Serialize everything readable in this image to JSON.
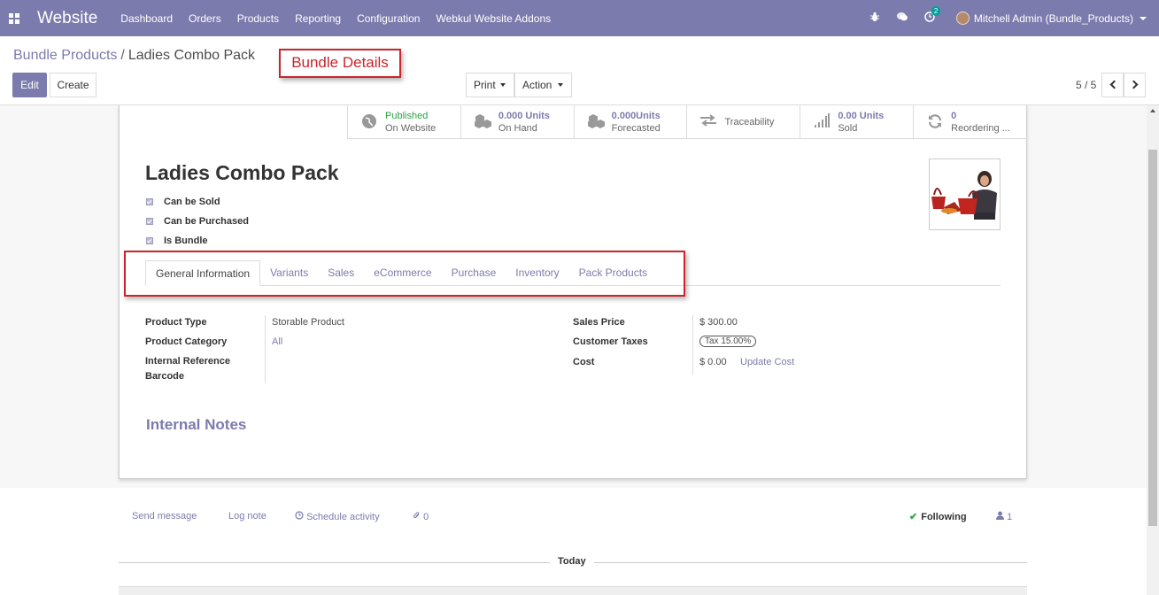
{
  "navbar": {
    "brand": "Website",
    "menu": [
      "Dashboard",
      "Orders",
      "Products",
      "Reporting",
      "Configuration",
      "Webkul Website Addons"
    ],
    "activity_count": "2",
    "user": "Mitchell Admin (Bundle_Products)"
  },
  "breadcrumb": {
    "parent": "Bundle Products",
    "separator": "/",
    "current": "Ladies Combo Pack"
  },
  "annotation": {
    "label": "Bundle Details",
    "color": "#c9252c"
  },
  "buttons": {
    "edit": "Edit",
    "create": "Create",
    "print": "Print",
    "action": "Action"
  },
  "pager": {
    "text": "5 / 5"
  },
  "smart_buttons": [
    {
      "icon": "globe-icon",
      "value": "Published",
      "label": "On Website"
    },
    {
      "icon": "cubes-icon",
      "value": "0.000 Units",
      "label": "On Hand"
    },
    {
      "icon": "cubes-icon",
      "value": "0.000Units",
      "label": "Forecasted"
    },
    {
      "icon": "exchange-icon",
      "value": "",
      "label": "Traceability"
    },
    {
      "icon": "signal-icon",
      "value": "0.00 Units",
      "label": "Sold"
    },
    {
      "icon": "refresh-icon",
      "value": "0",
      "label": "Reordering ..."
    }
  ],
  "product": {
    "name": "Ladies Combo Pack",
    "checkboxes": [
      "Can be Sold",
      "Can be Purchased",
      "Is Bundle"
    ]
  },
  "tabs": [
    "General Information",
    "Variants",
    "Sales",
    "eCommerce",
    "Purchase",
    "Inventory",
    "Pack Products"
  ],
  "fields_left": {
    "product_type_label": "Product Type",
    "product_type_value": "Storable Product",
    "category_label": "Product Category",
    "category_value": "All",
    "internal_ref_label": "Internal Reference",
    "barcode_label": "Barcode"
  },
  "fields_right": {
    "sales_price_label": "Sales Price",
    "sales_price_value": "$ 300.00",
    "taxes_label": "Customer Taxes",
    "taxes_value": "Tax 15.00%",
    "cost_label": "Cost",
    "cost_value": "$ 0.00",
    "update_cost": "Update Cost"
  },
  "notes_heading": "Internal Notes",
  "chatter": {
    "send_message": "Send message",
    "log_note": "Log note",
    "schedule_activity": "Schedule activity",
    "attachments": "0",
    "following": "Following",
    "followers": "1",
    "today": "Today"
  }
}
